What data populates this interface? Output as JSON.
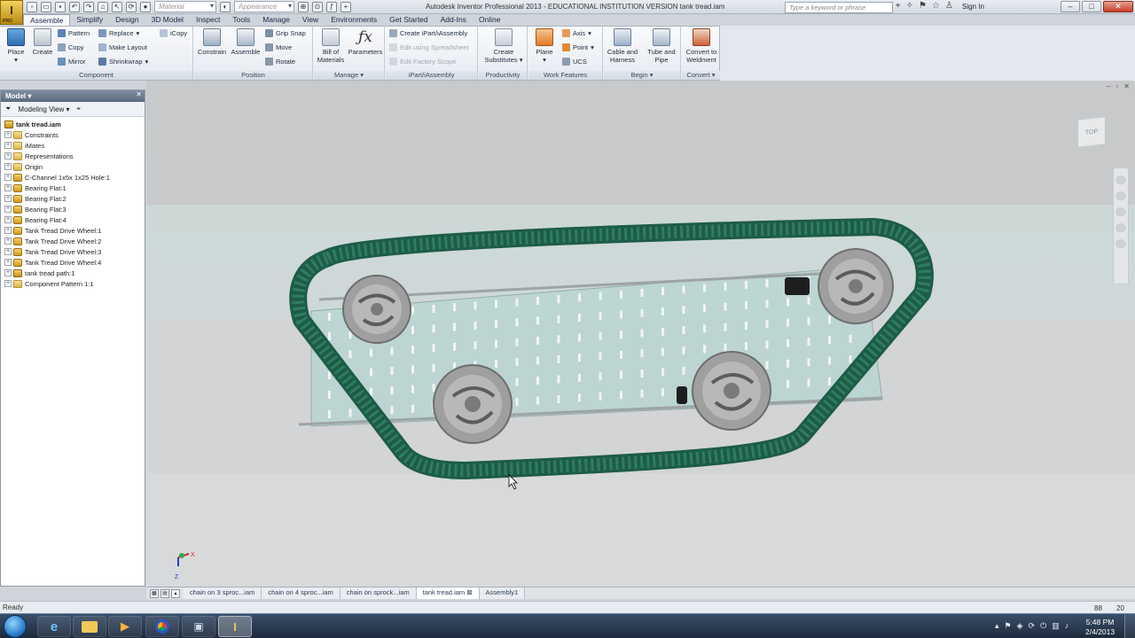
{
  "app": {
    "logo_label": "I",
    "logo_sub": "PRO",
    "window_title": "Autodesk Inventor Professional 2013 - EDUCATIONAL INSTITUTION VERSION  tank tread.iam",
    "material_placeholder": "Material",
    "appearance_placeholder": "Appearance",
    "search_placeholder": "Type a keyword or phrase",
    "sign_in": "Sign In"
  },
  "ribbon_tabs": [
    "Assemble",
    "Simplify",
    "Design",
    "3D Model",
    "Inspect",
    "Tools",
    "Manage",
    "View",
    "Environments",
    "Get Started",
    "Add-Ins",
    "Online"
  ],
  "ribbon": {
    "component": {
      "title": "Component",
      "place": "Place",
      "create": "Create",
      "pattern": "Pattern",
      "copy": "Copy",
      "mirror": "Mirror",
      "replace": "Replace",
      "make_layout": "Make Layout",
      "shrinkwrap": "Shrinkwrap",
      "icopy": "iCopy"
    },
    "position": {
      "title": "Position",
      "constrain": "Constrain",
      "assemble": "Assemble",
      "grip_snap": "Grip Snap",
      "move": "Move",
      "rotate": "Rotate"
    },
    "manage": {
      "title": "Manage",
      "bom_line1": "Bill of",
      "bom_line2": "Materials",
      "parameters": "Parameters"
    },
    "ipart": {
      "title": "iPart/iAssembly",
      "create": "Create iPart/iAssembly",
      "edit_spreadsheet": "Edit using Spreadsheet",
      "edit_factory": "Edit Factory Scope"
    },
    "productivity": {
      "title": "Productivity",
      "line1": "Create",
      "line2": "Substitutes"
    },
    "work_features": {
      "title": "Work Features",
      "plane": "Plane",
      "axis": "Axis",
      "point": "Point",
      "ucs": "UCS"
    },
    "begin": {
      "title": "Begin",
      "cable_line1": "Cable and",
      "cable_line2": "Harness",
      "tube_line1": "Tube and",
      "tube_line2": "Pipe"
    },
    "convert": {
      "title": "Convert",
      "line1": "Convert to",
      "line2": "Weldment"
    }
  },
  "browser": {
    "title": "Model",
    "view_mode": "Modeling View",
    "items": [
      {
        "label": "tank tread.iam",
        "type": "root"
      },
      {
        "label": "Constraints",
        "type": "folder"
      },
      {
        "label": "iMates",
        "type": "folder"
      },
      {
        "label": "Representations",
        "type": "folder"
      },
      {
        "label": "Origin",
        "type": "folder"
      },
      {
        "label": "C-Channel  1x5x 1x25 Hole:1",
        "type": "part"
      },
      {
        "label": "Bearing Flat:1",
        "type": "part"
      },
      {
        "label": "Bearing Flat:2",
        "type": "part"
      },
      {
        "label": "Bearing Flat:3",
        "type": "part"
      },
      {
        "label": "Bearing Flat:4",
        "type": "part"
      },
      {
        "label": "Tank Tread Drive Wheel:1",
        "type": "part"
      },
      {
        "label": "Tank Tread Drive Wheel:2",
        "type": "part"
      },
      {
        "label": "Tank Tread Drive Wheel:3",
        "type": "part"
      },
      {
        "label": "Tank Tread Drive Wheel:4",
        "type": "part"
      },
      {
        "label": "tank tread path:1",
        "type": "asm"
      },
      {
        "label": "Component Pattern 1:1",
        "type": "pattern"
      }
    ]
  },
  "viewport": {
    "viewcube_label": "TOP",
    "triad_x": "X",
    "triad_z": "Z"
  },
  "doc_tabs": [
    {
      "label": "chain on 3 sproc...iam",
      "active": false
    },
    {
      "label": "chain on 4 sproc...iam",
      "active": false
    },
    {
      "label": "chain on sprock...iam",
      "active": false
    },
    {
      "label": "tank tread.iam",
      "active": true
    },
    {
      "label": "Assembly1",
      "active": false
    }
  ],
  "status": {
    "text": "Ready",
    "count1": "88",
    "count2": "20"
  },
  "taskbar": {
    "time": "5:48 PM",
    "date": "2/4/2013"
  },
  "colors": {
    "tread": "#1d5c47",
    "plate": "#b9d6d2",
    "wheel": "#a7a7a7",
    "ribbon_bg": "#eef1f5",
    "accent": "#2a6fb8"
  }
}
